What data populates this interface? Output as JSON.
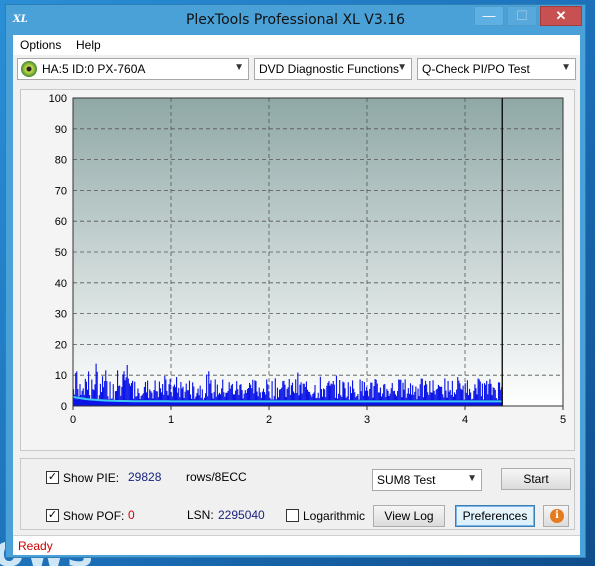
{
  "window": {
    "title": "PlexTools Professional XL V3.16",
    "app_icon_text": "XL",
    "minimize_glyph": "—",
    "maximize_glyph": "☐",
    "close_glyph": "✕"
  },
  "menu": {
    "items": [
      "Options",
      "Help"
    ]
  },
  "toolbar": {
    "drive": "HA:5 ID:0  PX-760A",
    "function": "DVD Diagnostic Functions",
    "test": "Q-Check PI/PO Test",
    "arrow_glyph": "▼"
  },
  "chart_data": {
    "type": "bar",
    "title": "",
    "xlabel": "",
    "ylabel": "",
    "xlim": [
      0,
      5
    ],
    "ylim": [
      0,
      100
    ],
    "x_ticks": [
      "0",
      "1",
      "2",
      "3",
      "4",
      "5"
    ],
    "y_ticks": [
      "0",
      "10",
      "20",
      "30",
      "40",
      "50",
      "60",
      "70",
      "80",
      "90",
      "100"
    ],
    "grid": true,
    "end_marker_x": 4.38,
    "series": [
      {
        "name": "",
        "kind": "bars",
        "color": "#0a14e6",
        "typical_range": [
          2,
          9
        ],
        "peak": 14,
        "x_end": 4.38
      },
      {
        "name": "",
        "kind": "line",
        "color": "#3cc8f0",
        "start": 3,
        "level": 1.5,
        "x_end": 4.38
      }
    ],
    "colors": {
      "plot_top": "#8fa8a6",
      "plot_bottom": "#ffffff",
      "frame": "#c8c8c8"
    }
  },
  "controls": {
    "show_pie_label": "Show PIE:",
    "show_pie_checked": true,
    "pie_value": "29828",
    "rows_label": "rows/8ECC",
    "sum_select": "SUM8 Test",
    "start_button": "Start",
    "show_poe_label": "Show POF:",
    "show_poe_checked": true,
    "poe_value": "0",
    "lsn_label": "LSN:",
    "lsn_value": "2295040",
    "log_label": "Logarithmic",
    "log_checked": false,
    "view_log_button": "View Log",
    "preferences_button": "Preferences",
    "info_glyph": "i",
    "check_glyph": "✓"
  },
  "status": {
    "text": "Ready"
  },
  "desktop": {
    "background_text": "ows"
  }
}
